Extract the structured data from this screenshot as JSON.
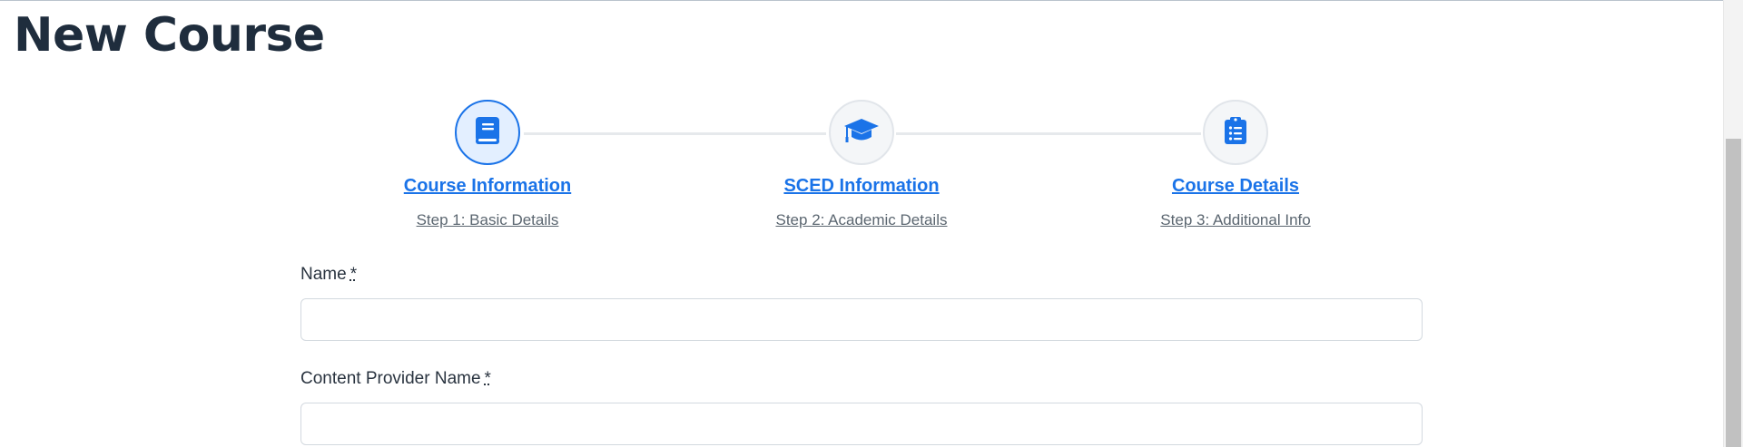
{
  "page": {
    "title": "New Course"
  },
  "stepper": {
    "active_step": 1,
    "steps": [
      {
        "title": "Course Information",
        "subtitle": "Step 1: Basic Details",
        "icon": "book-icon"
      },
      {
        "title": "SCED Information",
        "subtitle": "Step 2: Academic Details",
        "icon": "graduation-cap-icon"
      },
      {
        "title": "Course Details",
        "subtitle": "Step 3: Additional Info",
        "icon": "clipboard-list-icon"
      }
    ]
  },
  "form": {
    "required_marker": "*",
    "fields": [
      {
        "label": "Name",
        "value": "",
        "placeholder": ""
      },
      {
        "label": "Content Provider Name",
        "value": "",
        "placeholder": ""
      }
    ]
  },
  "colors": {
    "accent": "#1a73e8",
    "title": "#1f2d3d"
  }
}
